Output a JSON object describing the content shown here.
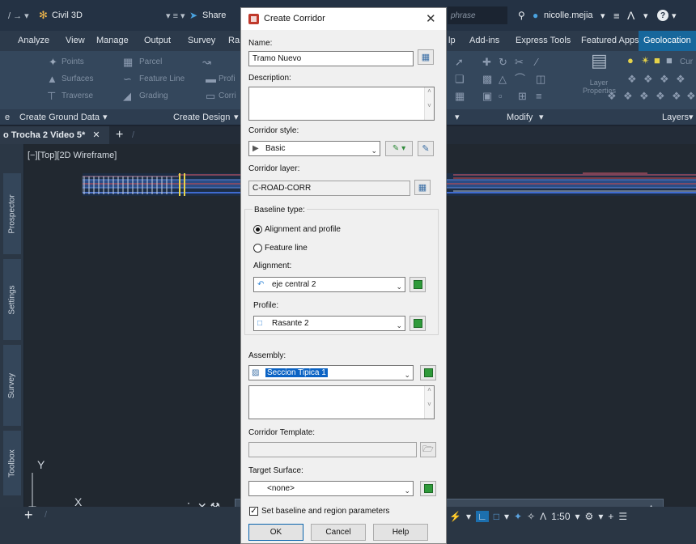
{
  "app": {
    "title": "Civil 3D",
    "share": "Share",
    "search_placeholder": "phrase",
    "user": "nicolle.mejia"
  },
  "ribbon_tabs": [
    "Analyze",
    "View",
    "Manage",
    "Output",
    "Survey",
    "Ra",
    "lp",
    "Add-ins",
    "Express Tools",
    "Featured Apps",
    "Geolocation"
  ],
  "ribbon_active_tab": "Geolocation",
  "ribbon_cmds": [
    "Points",
    "Surfaces",
    "Traverse",
    "Parcel",
    "Feature Line",
    "Grading",
    "Profi",
    "Corri",
    "Layer Properties",
    "Cur"
  ],
  "ribbon_bar": {
    "left": "on",
    "create_ground": "Create Ground Data",
    "create_design": "Create Design",
    "modify": "Modify",
    "layers": "Layers",
    "e": "e"
  },
  "doc_tab": {
    "label": "o Trocha 2 Video 5*"
  },
  "viewport_label": "[−][Top][2D Wireframe]",
  "palette_tabs": [
    "Prospector",
    "Settings",
    "Survey",
    "Toolbox"
  ],
  "ucs": {
    "y": "Y",
    "x": "X"
  },
  "statusbar": {
    "scale": "1:50"
  },
  "dialog": {
    "title": "Create Corridor",
    "name_label": "Name:",
    "name_value": "Tramo Nuevo",
    "description_label": "Description:",
    "description_value": "",
    "corridor_style_label": "Corridor style:",
    "corridor_style_value": "Basic",
    "corridor_layer_label": "Corridor layer:",
    "corridor_layer_value": "C-ROAD-CORR",
    "baseline_type_label": "Baseline type:",
    "radio_alignment_profile": "Alignment and profile",
    "radio_feature_line": "Feature line",
    "alignment_label": "Alignment:",
    "alignment_value": "eje central 2",
    "profile_label": "Profile:",
    "profile_value": "Rasante 2",
    "assembly_label": "Assembly:",
    "assembly_value": "Seccion Tipica 1",
    "template_label": "Corridor Template:",
    "template_value": "",
    "target_label": "Target Surface:",
    "target_value": "<none>",
    "set_baseline_label": "Set baseline and region parameters",
    "ok": "OK",
    "cancel": "Cancel",
    "help": "Help"
  }
}
